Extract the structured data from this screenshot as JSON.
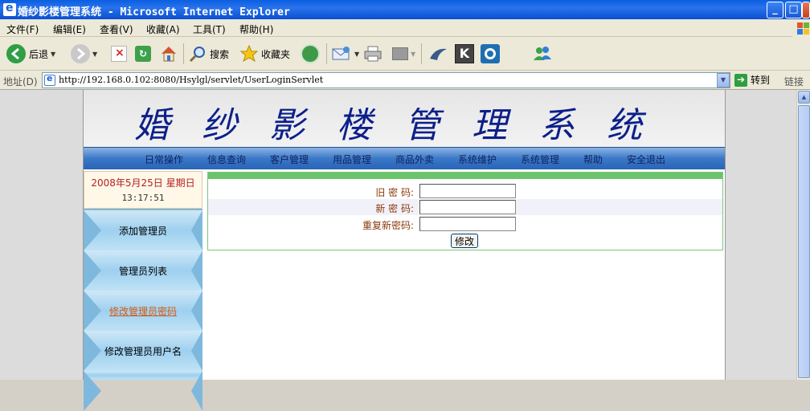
{
  "window": {
    "title": "婚纱影楼管理系统 - Microsoft Internet Explorer",
    "controls": {
      "minimize": "_",
      "maximize": "□",
      "close": "×"
    }
  },
  "menubar": {
    "items": [
      "文件(F)",
      "编辑(E)",
      "查看(V)",
      "收藏(A)",
      "工具(T)",
      "帮助(H)"
    ]
  },
  "toolbar": {
    "back_label": "后退",
    "search_label": "搜索",
    "favorites_label": "收藏夹"
  },
  "addressbar": {
    "label": "地址(D)",
    "url": "http://192.168.0.102:8080/Hsylgl/servlet/UserLoginServlet",
    "go_label": "转到",
    "links_label": "链接"
  },
  "page": {
    "system_title": "婚纱影楼管理系统",
    "nav": [
      "日常操作",
      "信息查询",
      "客户管理",
      "用品管理",
      "商品外卖",
      "系统维护",
      "系统管理",
      "帮助",
      "安全退出"
    ],
    "date": "2008年5月25日  星期日",
    "time": "13:17:51",
    "sidebar": [
      {
        "label": "添加管理员",
        "active": false
      },
      {
        "label": "管理员列表",
        "active": false
      },
      {
        "label": "修改管理员密码",
        "active": true
      },
      {
        "label": "修改管理员用户名",
        "active": false
      }
    ],
    "form": {
      "old_password_label": "旧  密  码:",
      "new_password_label": "新  密  码:",
      "repeat_password_label": "重复新密码:",
      "old_password_value": "",
      "new_password_value": "",
      "repeat_password_value": "",
      "submit_label": "修改"
    }
  },
  "colors": {
    "title_text": "#0c1f8a",
    "nav_bar": "#3a78c8",
    "form_accent": "#6ac46a",
    "active_link": "#d65a10"
  }
}
